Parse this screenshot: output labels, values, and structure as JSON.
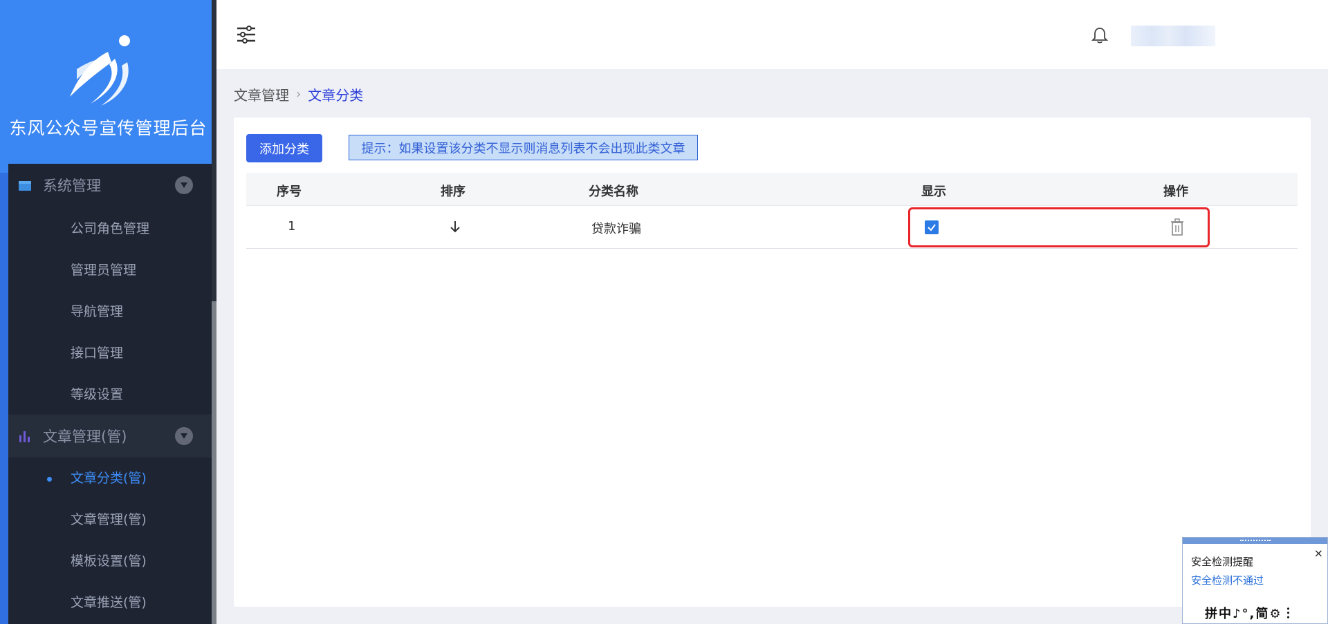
{
  "brand": {
    "title": "东风公众号宣传管理后台"
  },
  "sidebar": {
    "groups": [
      {
        "label": "系统管理",
        "icon": "calendar-icon"
      },
      {
        "label": "文章管理(管)",
        "icon": "bar-chart-icon"
      }
    ],
    "system_items": [
      "公司角色管理",
      "管理员管理",
      "导航管理",
      "接口管理",
      "等级设置"
    ],
    "article_items": [
      "文章分类(管)",
      "文章管理(管)",
      "模板设置(管)",
      "文章推送(管)"
    ],
    "active_item": "文章分类(管)"
  },
  "header": {
    "icons": [
      "filter-icon",
      "bell-icon"
    ]
  },
  "breadcrumb": {
    "parent": "文章管理",
    "current": "文章分类"
  },
  "toolbar": {
    "add_label": "添加分类",
    "hint": "提示：如果设置该分类不显示则消息列表不会出现此类文章"
  },
  "table": {
    "headers": [
      "序号",
      "排序",
      "分类名称",
      "显示",
      "操作"
    ],
    "rows": [
      {
        "index": "1",
        "name": "贷款诈骗",
        "visible": true
      }
    ]
  },
  "popup": {
    "title": "安全检测提醒",
    "link": "安全检测不通过",
    "close": "×",
    "ime": "拼中♪°,简⚙︙"
  },
  "colors": {
    "accent": "#3a86f2",
    "sidebar_bg": "#1f2433",
    "highlight": "#e8262b"
  }
}
